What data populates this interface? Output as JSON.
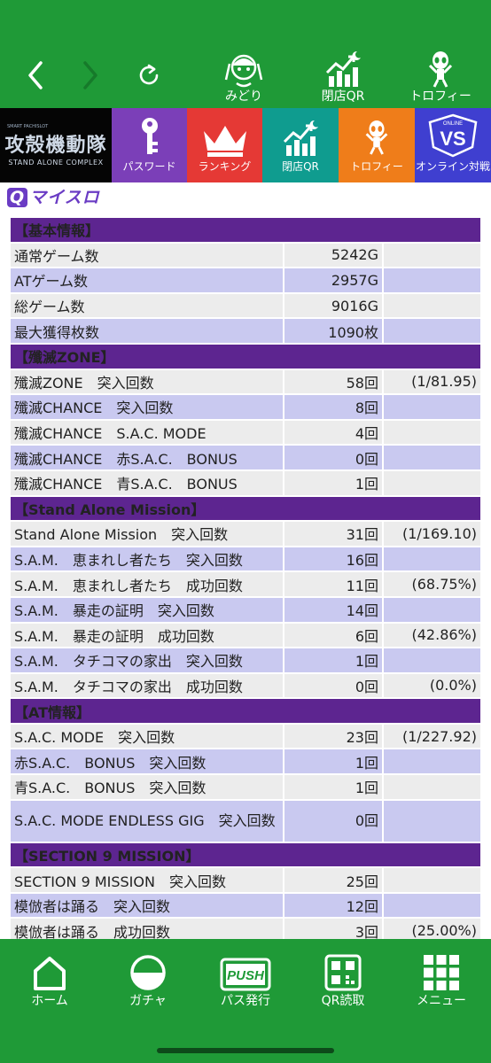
{
  "topbar": {
    "items": [
      {
        "label": "みどり",
        "icon": "character-icon"
      },
      {
        "label": "閉店QR",
        "icon": "chart-moon-icon"
      },
      {
        "label": "トロフィー",
        "icon": "trophy-figure-icon"
      }
    ]
  },
  "tiles": {
    "logo": {
      "main": "攻殻機動隊",
      "sub": "STAND ALONE COMPLEX",
      "small": "SMART PACHISLOT"
    },
    "items": [
      {
        "label": "パスワード",
        "color": "#7b3fb8"
      },
      {
        "label": "ランキング",
        "color": "#e53935"
      },
      {
        "label": "閉店QR",
        "color": "#0f9c8f"
      },
      {
        "label": "トロフィー",
        "color": "#ef7d1a"
      },
      {
        "label": "オンライン対戦",
        "color": "#3f3fd0",
        "badge_top": "ONLINE",
        "badge_main": "VS"
      }
    ]
  },
  "brand": {
    "q": "Q",
    "text": "マイスロ"
  },
  "sections": [
    {
      "title": "【基本情報】",
      "rows": [
        {
          "label": "通常ゲーム数",
          "value": "5242G",
          "rate": ""
        },
        {
          "label": "ATゲーム数",
          "value": "2957G",
          "rate": ""
        },
        {
          "label": "総ゲーム数",
          "value": "9016G",
          "rate": ""
        },
        {
          "label": "最大獲得枚数",
          "value": "1090枚",
          "rate": ""
        }
      ]
    },
    {
      "title": "【殲滅ZONE】",
      "rows": [
        {
          "label": "殲滅ZONE　突入回数",
          "value": "58回",
          "rate": "(1/81.95)"
        },
        {
          "label": "殲滅CHANCE　突入回数",
          "value": "8回",
          "rate": ""
        },
        {
          "label": "殲滅CHANCE　S.A.C. MODE",
          "value": "4回",
          "rate": ""
        },
        {
          "label": "殲滅CHANCE　赤S.A.C.　BONUS",
          "value": "0回",
          "rate": ""
        },
        {
          "label": "殲滅CHANCE　青S.A.C.　BONUS",
          "value": "1回",
          "rate": ""
        }
      ]
    },
    {
      "title": "【Stand Alone Mission】",
      "rows": [
        {
          "label": "Stand Alone Mission　突入回数",
          "value": "31回",
          "rate": "(1/169.10)"
        },
        {
          "label": "S.A.M.　恵まれし者たち　突入回数",
          "value": "16回",
          "rate": ""
        },
        {
          "label": "S.A.M.　恵まれし者たち　成功回数",
          "value": "11回",
          "rate": "(68.75%)"
        },
        {
          "label": "S.A.M.　暴走の証明　突入回数",
          "value": "14回",
          "rate": ""
        },
        {
          "label": "S.A.M.　暴走の証明　成功回数",
          "value": "6回",
          "rate": "(42.86%)"
        },
        {
          "label": "S.A.M.　タチコマの家出　突入回数",
          "value": "1回",
          "rate": ""
        },
        {
          "label": "S.A.M.　タチコマの家出　成功回数",
          "value": "0回",
          "rate": "(0.0%)"
        }
      ]
    },
    {
      "title": "【AT情報】",
      "rows": [
        {
          "label": "S.A.C. MODE　突入回数",
          "value": "23回",
          "rate": "(1/227.92)"
        },
        {
          "label": "赤S.A.C.　BONUS　突入回数",
          "value": "1回",
          "rate": ""
        },
        {
          "label": "青S.A.C.　BONUS　突入回数",
          "value": "1回",
          "rate": ""
        },
        {
          "label": "S.A.C. MODE ENDLESS GIG　突入回数",
          "value": "0回",
          "rate": "",
          "tall": true
        }
      ]
    },
    {
      "title": "【SECTION 9 MISSION】",
      "rows": [
        {
          "label": "SECTION 9 MISSION　突入回数",
          "value": "25回",
          "rate": ""
        },
        {
          "label": "模倣者は踊る　突入回数",
          "value": "12回",
          "rate": ""
        },
        {
          "label": "模倣者は踊る　成功回数",
          "value": "3回",
          "rate": "(25.00%)"
        }
      ]
    }
  ],
  "bottom_nav": [
    {
      "label": "ホーム",
      "icon": "home-icon"
    },
    {
      "label": "ガチャ",
      "icon": "gacha-icon"
    },
    {
      "label": "パス発行",
      "icon": "push-icon",
      "badge": "PUSH"
    },
    {
      "label": "QR読取",
      "icon": "qr-icon"
    },
    {
      "label": "メニュー",
      "icon": "menu-grid-icon"
    }
  ]
}
